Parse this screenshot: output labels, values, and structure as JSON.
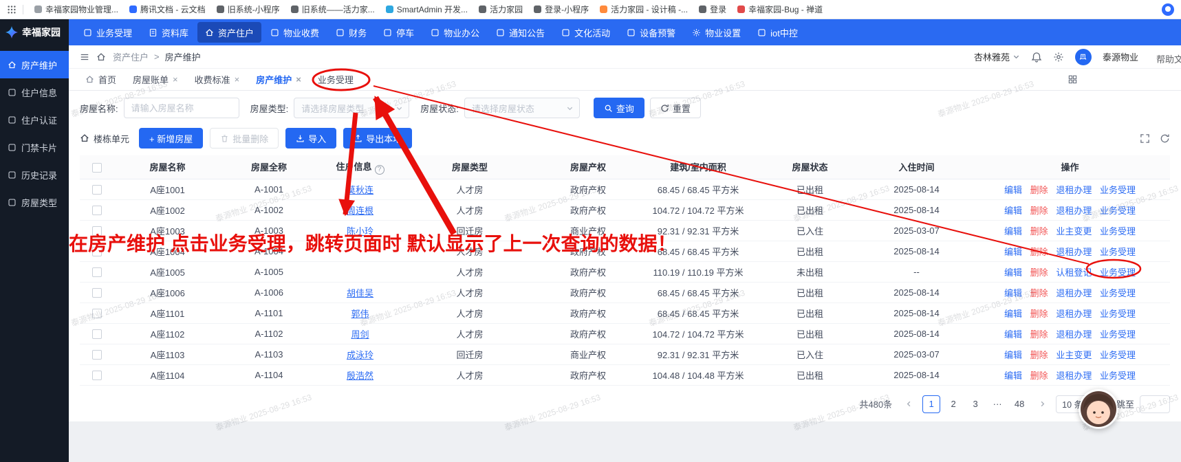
{
  "theme": {
    "accent": "#2468f2",
    "topnav": "#2a6af2",
    "sidebar": "#141b26",
    "link": "#2b6bf3",
    "danger": "#f25555"
  },
  "watermark": {
    "text": "泰源物业 2025-08-29 16:53"
  },
  "annotation": {
    "note": "在房产维护 点击业务受理，跳转页面时 默认显示了上一次查询的数据！",
    "color": "#e8100c"
  },
  "browser": {
    "bookmarks": [
      {
        "label": "幸福家园物业管理...",
        "color": "#9aa0a6"
      },
      {
        "label": "腾讯文档 - 云文档",
        "color": "#2f6bff"
      },
      {
        "label": "旧系统-小程序",
        "color": "#5f6368"
      },
      {
        "label": "旧系统——活力家...",
        "color": "#5f6368"
      },
      {
        "label": "SmartAdmin 开发...",
        "color": "#2ea7e0"
      },
      {
        "label": "活力家园",
        "color": "#5f6368"
      },
      {
        "label": "登录-小程序",
        "color": "#5f6368"
      },
      {
        "label": "活力家园 - 设计稿 -...",
        "color": "#ff8a3c"
      },
      {
        "label": "登录",
        "color": "#5f6368"
      },
      {
        "label": "幸福家园-Bug - 禅道",
        "color": "#e14a4a"
      }
    ]
  },
  "topnav": {
    "brand": "幸福家园",
    "items": [
      {
        "label": "业务受理",
        "icon": "square"
      },
      {
        "label": "资料库",
        "icon": "doc"
      },
      {
        "label": "资产住户",
        "icon": "home",
        "active": true
      },
      {
        "label": "物业收费",
        "icon": "square"
      },
      {
        "label": "财务",
        "icon": "square"
      },
      {
        "label": "停车",
        "icon": "square"
      },
      {
        "label": "物业办公",
        "icon": "square"
      },
      {
        "label": "通知公告",
        "icon": "square"
      },
      {
        "label": "文化活动",
        "icon": "square"
      },
      {
        "label": "设备预警",
        "icon": "square"
      },
      {
        "label": "物业设置",
        "icon": "gear"
      },
      {
        "label": "iot中控",
        "icon": "square"
      }
    ]
  },
  "sidebar": {
    "items": [
      {
        "label": "房产维护",
        "icon": "home",
        "active": true
      },
      {
        "label": "住户信息",
        "icon": "square"
      },
      {
        "label": "住户认证",
        "icon": "square"
      },
      {
        "label": "门禁卡片",
        "icon": "square"
      },
      {
        "label": "历史记录",
        "icon": "square"
      },
      {
        "label": "房屋类型",
        "icon": "square"
      }
    ]
  },
  "header": {
    "breadcrumb_parent": "资产住户",
    "breadcrumb_sep": ">",
    "breadcrumb_current": "房产维护",
    "project": "杏林雅苑",
    "user": "泰源物业",
    "help": "帮助文档"
  },
  "tabs": [
    {
      "label": "首页",
      "icon": "home"
    },
    {
      "label": "房屋账单",
      "closable": true
    },
    {
      "label": "收费标准",
      "closable": true
    },
    {
      "label": "房产维护",
      "closable": true,
      "active": true
    },
    {
      "label": "业务受理"
    }
  ],
  "filters": {
    "name_label": "房屋名称:",
    "name_placeholder": "请输入房屋名称",
    "type_label": "房屋类型:",
    "type_placeholder": "请选择房屋类型",
    "status_label": "房屋状态:",
    "status_placeholder": "请选择房屋状态",
    "search_label": "查询",
    "reset_label": "重置"
  },
  "toolbar": {
    "building_unit": "楼栋单元",
    "add_label": "+ 新增房屋",
    "batch_delete_label": "批量删除",
    "import_label": "导入",
    "export_label": "导出本地"
  },
  "table": {
    "columns": [
      "房屋名称",
      "房屋全称",
      "住户信息",
      "房屋类型",
      "房屋产权",
      "建筑/室内面积",
      "房屋状态",
      "入住时间",
      "操作"
    ],
    "rows": [
      {
        "name": "A座1001",
        "full": "A-1001",
        "resident": "莫秋连",
        "type": "人才房",
        "own": "政府产权",
        "area": "68.45 / 68.45 平方米",
        "status": "已出租",
        "date": "2025-08-14",
        "ops": [
          {
            "label": "编辑"
          },
          {
            "label": "删除",
            "danger": true
          },
          {
            "label": "退租办理"
          },
          {
            "label": "业务受理"
          }
        ]
      },
      {
        "name": "A座1002",
        "full": "A-1002",
        "resident": "周连根",
        "type": "人才房",
        "own": "政府产权",
        "area": "104.72 / 104.72 平方米",
        "status": "已出租",
        "date": "2025-08-14",
        "ops": [
          {
            "label": "编辑"
          },
          {
            "label": "删除",
            "danger": true
          },
          {
            "label": "退租办理"
          },
          {
            "label": "业务受理"
          }
        ]
      },
      {
        "name": "A座1003",
        "full": "A-1003",
        "resident": "陈小玲",
        "type": "回迁房",
        "own": "商业产权",
        "area": "92.31 / 92.31 平方米",
        "status": "已入住",
        "date": "2025-03-07",
        "ops": [
          {
            "label": "编辑"
          },
          {
            "label": "删除",
            "danger": true
          },
          {
            "label": "业主变更"
          },
          {
            "label": "业务受理"
          }
        ]
      },
      {
        "name": "A座1004",
        "full": "A-1004",
        "resident": "",
        "type": "人才房",
        "own": "政府产权",
        "area": "68.45 / 68.45 平方米",
        "status": "已出租",
        "date": "2025-08-14",
        "ops": [
          {
            "label": "编辑"
          },
          {
            "label": "删除",
            "danger": true
          },
          {
            "label": "退租办理"
          },
          {
            "label": "业务受理"
          }
        ]
      },
      {
        "name": "A座1005",
        "full": "A-1005",
        "resident": "",
        "type": "人才房",
        "own": "政府产权",
        "area": "110.19 / 110.19 平方米",
        "status": "未出租",
        "date": "--",
        "ops": [
          {
            "label": "编辑"
          },
          {
            "label": "删除",
            "danger": true
          },
          {
            "label": "认租登记"
          },
          {
            "label": "业务受理"
          }
        ]
      },
      {
        "name": "A座1006",
        "full": "A-1006",
        "resident": "胡佳吴",
        "type": "人才房",
        "own": "政府产权",
        "area": "68.45 / 68.45 平方米",
        "status": "已出租",
        "date": "2025-08-14",
        "ops": [
          {
            "label": "编辑"
          },
          {
            "label": "删除",
            "danger": true
          },
          {
            "label": "退租办理"
          },
          {
            "label": "业务受理"
          }
        ]
      },
      {
        "name": "A座1101",
        "full": "A-1101",
        "resident": "郭伟",
        "type": "人才房",
        "own": "政府产权",
        "area": "68.45 / 68.45 平方米",
        "status": "已出租",
        "date": "2025-08-14",
        "ops": [
          {
            "label": "编辑"
          },
          {
            "label": "删除",
            "danger": true
          },
          {
            "label": "退租办理"
          },
          {
            "label": "业务受理"
          }
        ]
      },
      {
        "name": "A座1102",
        "full": "A-1102",
        "resident": "周剑",
        "type": "人才房",
        "own": "政府产权",
        "area": "104.72 / 104.72 平方米",
        "status": "已出租",
        "date": "2025-08-14",
        "ops": [
          {
            "label": "编辑"
          },
          {
            "label": "删除",
            "danger": true
          },
          {
            "label": "退租办理"
          },
          {
            "label": "业务受理"
          }
        ]
      },
      {
        "name": "A座1103",
        "full": "A-1103",
        "resident": "成泳玲",
        "type": "回迁房",
        "own": "商业产权",
        "area": "92.31 / 92.31 平方米",
        "status": "已入住",
        "date": "2025-03-07",
        "ops": [
          {
            "label": "编辑"
          },
          {
            "label": "删除",
            "danger": true
          },
          {
            "label": "业主变更"
          },
          {
            "label": "业务受理"
          }
        ]
      },
      {
        "name": "A座1104",
        "full": "A-1104",
        "resident": "殷浩然",
        "type": "人才房",
        "own": "政府产权",
        "area": "104.48 / 104.48 平方米",
        "status": "已出租",
        "date": "2025-08-14",
        "ops": [
          {
            "label": "编辑"
          },
          {
            "label": "删除",
            "danger": true
          },
          {
            "label": "退租办理"
          },
          {
            "label": "业务受理"
          }
        ]
      }
    ]
  },
  "pagination": {
    "total_label": "共480条",
    "pages": [
      {
        "label": "1",
        "active": true
      },
      {
        "label": "2"
      },
      {
        "label": "3"
      },
      {
        "label": "···"
      },
      {
        "label": "48"
      }
    ],
    "page_size": "10 条/页",
    "jump_label": "跳至"
  }
}
